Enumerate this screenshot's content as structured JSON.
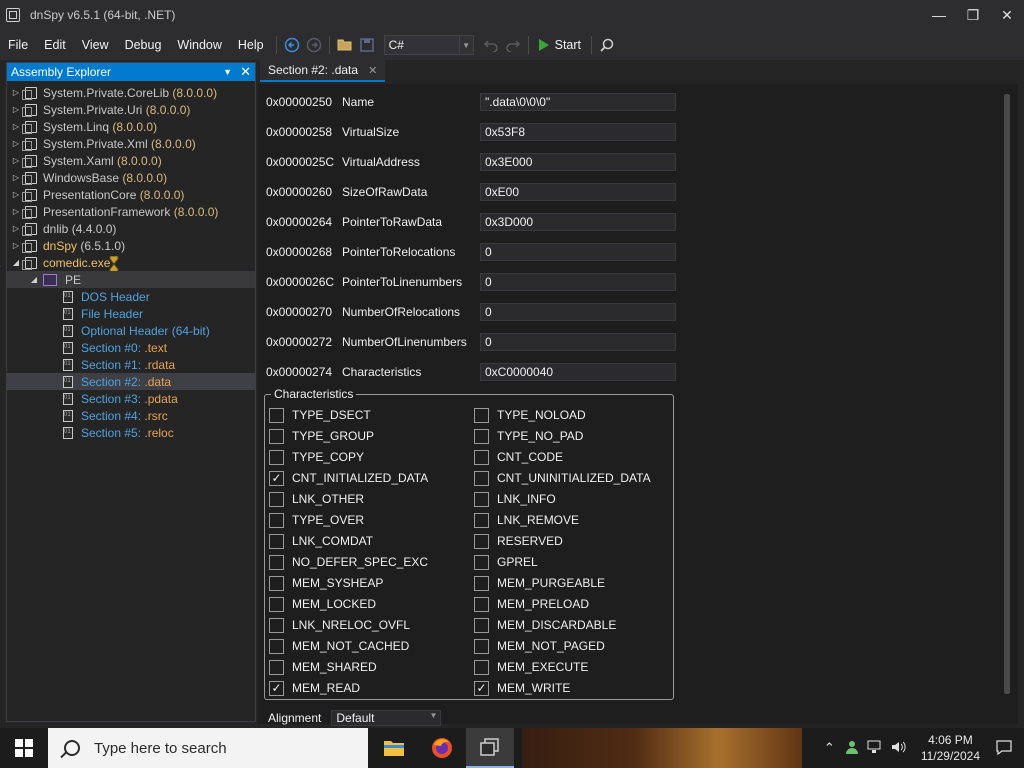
{
  "window": {
    "title": "dnSpy v6.5.1 (64-bit, .NET)",
    "controls": {
      "minimize": "—",
      "maximize": "❐",
      "close": "✕"
    }
  },
  "menu": [
    "File",
    "Edit",
    "View",
    "Debug",
    "Window",
    "Help"
  ],
  "toolbar": {
    "language": "C#",
    "start_label": "Start"
  },
  "explorer": {
    "title": "Assembly Explorer",
    "assemblies": [
      {
        "name": "System.Private.CoreLib",
        "version": "(8.0.0.0)"
      },
      {
        "name": "System.Private.Uri",
        "version": "(8.0.0.0)"
      },
      {
        "name": "System.Linq",
        "version": "(8.0.0.0)"
      },
      {
        "name": "System.Private.Xml",
        "version": "(8.0.0.0)"
      },
      {
        "name": "System.Xaml",
        "version": "(8.0.0.0)"
      },
      {
        "name": "WindowsBase",
        "version": "(8.0.0.0)"
      },
      {
        "name": "PresentationCore",
        "version": "(8.0.0.0)"
      },
      {
        "name": "PresentationFramework",
        "version": "(8.0.0.0)"
      },
      {
        "name": "dnlib",
        "version": "(4.4.0.0)"
      },
      {
        "name": "dnSpy",
        "version": "(6.5.1.0)"
      },
      {
        "name": "comedic.exe",
        "version": ""
      }
    ],
    "pe_label": "PE",
    "headers": [
      "DOS Header",
      "File Header",
      "Optional Header (64-bit)"
    ],
    "sections": [
      {
        "name": "Section #0:",
        "suffix": ".text"
      },
      {
        "name": "Section #1:",
        "suffix": ".rdata"
      },
      {
        "name": "Section #2:",
        "suffix": ".data"
      },
      {
        "name": "Section #3:",
        "suffix": ".pdata"
      },
      {
        "name": "Section #4:",
        "suffix": ".rsrc"
      },
      {
        "name": "Section #5:",
        "suffix": ".reloc"
      }
    ]
  },
  "tab": {
    "label": "Section #2: .data"
  },
  "fields": [
    {
      "offset": "0x00000250",
      "name": "Name",
      "value": "\".data\\0\\0\\0\""
    },
    {
      "offset": "0x00000258",
      "name": "VirtualSize",
      "value": "0x53F8"
    },
    {
      "offset": "0x0000025C",
      "name": "VirtualAddress",
      "value": "0x3E000"
    },
    {
      "offset": "0x00000260",
      "name": "SizeOfRawData",
      "value": "0xE00"
    },
    {
      "offset": "0x00000264",
      "name": "PointerToRawData",
      "value": "0x3D000"
    },
    {
      "offset": "0x00000268",
      "name": "PointerToRelocations",
      "value": "0"
    },
    {
      "offset": "0x0000026C",
      "name": "PointerToLinenumbers",
      "value": "0"
    },
    {
      "offset": "0x00000270",
      "name": "NumberOfRelocations",
      "value": "0"
    },
    {
      "offset": "0x00000272",
      "name": "NumberOfLinenumbers",
      "value": "0"
    },
    {
      "offset": "0x00000274",
      "name": "Characteristics",
      "value": "0xC0000040"
    }
  ],
  "characteristics": {
    "title": "Characteristics",
    "left": [
      {
        "label": "TYPE_DSECT",
        "checked": false
      },
      {
        "label": "TYPE_GROUP",
        "checked": false
      },
      {
        "label": "TYPE_COPY",
        "checked": false
      },
      {
        "label": "CNT_INITIALIZED_DATA",
        "checked": true
      },
      {
        "label": "LNK_OTHER",
        "checked": false
      },
      {
        "label": "TYPE_OVER",
        "checked": false
      },
      {
        "label": "LNK_COMDAT",
        "checked": false
      },
      {
        "label": "NO_DEFER_SPEC_EXC",
        "checked": false
      },
      {
        "label": "MEM_SYSHEAP",
        "checked": false
      },
      {
        "label": "MEM_LOCKED",
        "checked": false
      },
      {
        "label": "LNK_NRELOC_OVFL",
        "checked": false
      },
      {
        "label": "MEM_NOT_CACHED",
        "checked": false
      },
      {
        "label": "MEM_SHARED",
        "checked": false
      },
      {
        "label": "MEM_READ",
        "checked": true
      }
    ],
    "right": [
      {
        "label": "TYPE_NOLOAD",
        "checked": false
      },
      {
        "label": "TYPE_NO_PAD",
        "checked": false
      },
      {
        "label": "CNT_CODE",
        "checked": false
      },
      {
        "label": "CNT_UNINITIALIZED_DATA",
        "checked": false
      },
      {
        "label": "LNK_INFO",
        "checked": false
      },
      {
        "label": "LNK_REMOVE",
        "checked": false
      },
      {
        "label": "RESERVED",
        "checked": false
      },
      {
        "label": "GPREL",
        "checked": false
      },
      {
        "label": "MEM_PURGEABLE",
        "checked": false
      },
      {
        "label": "MEM_PRELOAD",
        "checked": false
      },
      {
        "label": "MEM_DISCARDABLE",
        "checked": false
      },
      {
        "label": "MEM_NOT_PAGED",
        "checked": false
      },
      {
        "label": "MEM_EXECUTE",
        "checked": false
      },
      {
        "label": "MEM_WRITE",
        "checked": true
      }
    ]
  },
  "alignment": {
    "label": "Alignment",
    "value": "Default"
  },
  "taskbar": {
    "search_placeholder": "Type here to search",
    "time": "4:06 PM",
    "date": "11/29/2024"
  },
  "colors": {
    "accent": "#007acc",
    "editor_bg": "#1e1e1e",
    "chrome_bg": "#2d2d30",
    "section_link": "#4fa3e0",
    "section_suffix": "#e8a34f"
  }
}
